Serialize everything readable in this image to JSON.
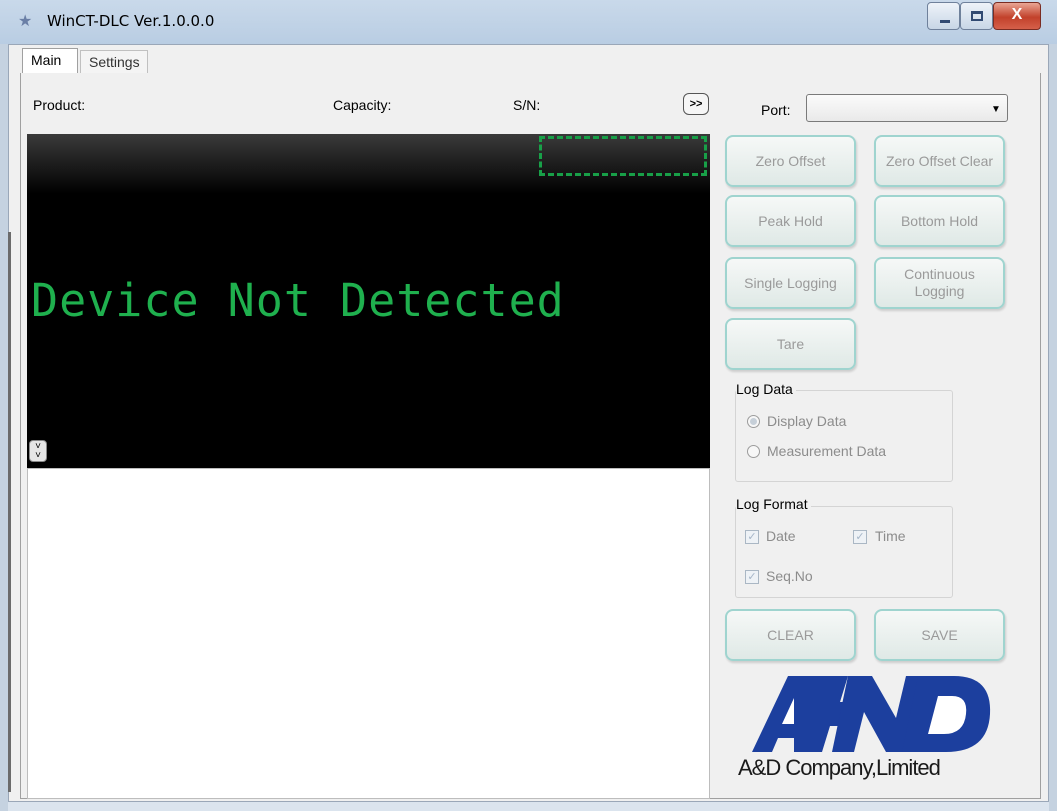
{
  "window": {
    "title": "WinCT-DLC Ver.1.0.0.0",
    "icon": "app-icon",
    "controls": {
      "minimize": "minimize-icon",
      "maximize": "maximize-icon",
      "close_label": "X"
    }
  },
  "tabs": [
    {
      "label": "Main",
      "active": true
    },
    {
      "label": "Settings",
      "active": false
    }
  ],
  "header": {
    "product_label": "Product:",
    "capacity_label": "Capacity:",
    "serial_label": "S/N:",
    "expand_label": ">>"
  },
  "display": {
    "message": "Device Not Detected",
    "message_color": "#1fb04e",
    "background": "#000000",
    "collapse_label": "v v"
  },
  "port": {
    "label": "Port:",
    "selected": ""
  },
  "buttons": {
    "zero_offset": "Zero Offset",
    "zero_offset_clear": "Zero Offset Clear",
    "peak_hold": "Peak Hold",
    "bottom_hold": "Bottom Hold",
    "single_logging": "Single Logging",
    "continuous_logging": "Continuous Logging",
    "tare": "Tare",
    "clear": "CLEAR",
    "save": "SAVE"
  },
  "log_data": {
    "title": "Log Data",
    "options": [
      {
        "label": "Display Data",
        "selected": true
      },
      {
        "label": "Measurement Data",
        "selected": false
      }
    ]
  },
  "log_format": {
    "title": "Log Format",
    "date": {
      "label": "Date",
      "checked": true
    },
    "time": {
      "label": "Time",
      "checked": true
    },
    "seq": {
      "label": "Seq.No",
      "checked": true
    }
  },
  "logo": {
    "mark_text": "A&D",
    "company": "A&D Company,Limited",
    "color": "#1c3f9e"
  }
}
